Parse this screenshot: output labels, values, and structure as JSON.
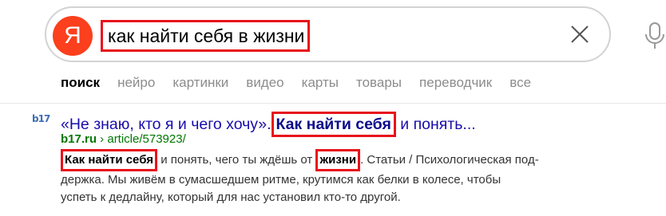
{
  "search": {
    "logo_text": "Я",
    "query": "как найти себя в жизни",
    "clear_icon": "close-icon",
    "mic_icon": "microphone-icon"
  },
  "tabs": [
    {
      "label": "поиск",
      "active": true
    },
    {
      "label": "нейро",
      "active": false
    },
    {
      "label": "картинки",
      "active": false
    },
    {
      "label": "видео",
      "active": false
    },
    {
      "label": "карты",
      "active": false
    },
    {
      "label": "товары",
      "active": false
    },
    {
      "label": "переводчик",
      "active": false
    },
    {
      "label": "все",
      "active": false
    }
  ],
  "result": {
    "favicon_text": "b17",
    "title_before": "«Не знаю, кто я и чего хочу».",
    "title_highlight": "Как найти себя",
    "title_after": "и понять...",
    "url_domain": "b17.ru",
    "url_path": " › article/573923/",
    "snippet_hl1": "Как найти себя",
    "snippet_part1": " и понять, чего ты ждёшь от ",
    "snippet_hl2": "жизни",
    "snippet_part2": ". Статьи / Психологическая под-",
    "snippet_line2": "держка. Мы живём в сумасшедшем ритме, крутимся как белки в колесе, чтобы",
    "snippet_line3": "успеть к дедлайну, который для нас установил кто-то другой."
  },
  "colors": {
    "brand": "#fc3f1d",
    "link": "#1a0dab",
    "url": "#007700",
    "highlight_box": "#e8111a"
  }
}
